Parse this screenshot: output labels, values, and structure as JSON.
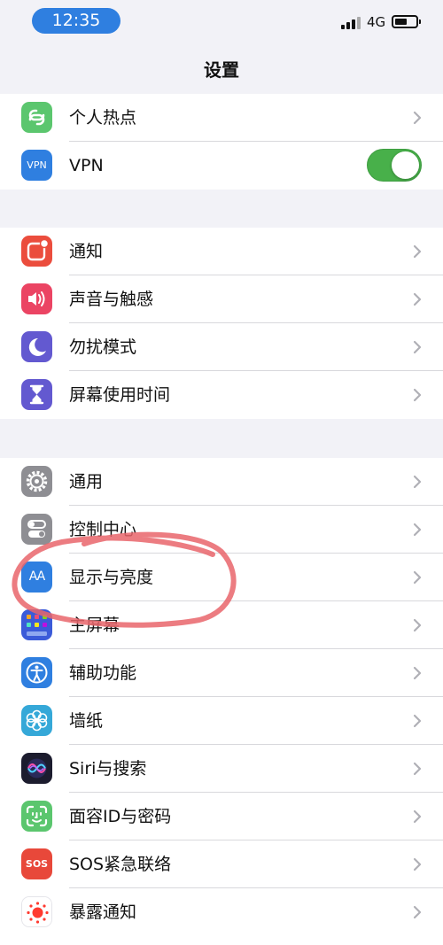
{
  "status_bar": {
    "time": "12:35",
    "network": "4G",
    "battery_level": 0.6
  },
  "nav": {
    "title": "设置"
  },
  "groups": [
    {
      "rows": [
        {
          "label": "个人热点",
          "icon": "personal-hotspot-icon",
          "color": "#5bc66e",
          "accessory": "chevron"
        },
        {
          "label": "VPN",
          "icon": "vpn-icon",
          "icon_text": "VPN",
          "color": "#2f7fe0",
          "accessory": "toggle",
          "toggle_on": true
        }
      ]
    },
    {
      "rows": [
        {
          "label": "通知",
          "icon": "notifications-icon",
          "color": "#eb4d3d",
          "accessory": "chevron"
        },
        {
          "label": "声音与触感",
          "icon": "sounds-icon",
          "color": "#eb4463",
          "accessory": "chevron"
        },
        {
          "label": "勿扰模式",
          "icon": "moon-icon",
          "color": "#6359d0",
          "accessory": "chevron"
        },
        {
          "label": "屏幕使用时间",
          "icon": "hourglass-icon",
          "color": "#6359d0",
          "accessory": "chevron"
        }
      ]
    },
    {
      "rows": [
        {
          "label": "通用",
          "icon": "gear-icon",
          "color": "#8e8e93",
          "accessory": "chevron"
        },
        {
          "label": "控制中心",
          "icon": "control-center-icon",
          "color": "#8e8e93",
          "accessory": "chevron"
        },
        {
          "label": "显示与亮度",
          "icon": "display-brightness-icon",
          "icon_text": "AA",
          "color": "#2f7fe0",
          "accessory": "chevron"
        },
        {
          "label": "主屏幕",
          "icon": "home-screen-icon",
          "color": "#3b5bd9",
          "accessory": "chevron"
        },
        {
          "label": "辅助功能",
          "icon": "accessibility-icon",
          "color": "#2f7fe0",
          "accessory": "chevron"
        },
        {
          "label": "墙纸",
          "icon": "wallpaper-icon",
          "color": "#35a8d8",
          "accessory": "chevron"
        },
        {
          "label": "Siri与搜索",
          "icon": "siri-icon",
          "color": "#1c1c2e",
          "accessory": "chevron"
        },
        {
          "label": "面容ID与密码",
          "icon": "face-id-icon",
          "color": "#5bc66e",
          "accessory": "chevron"
        },
        {
          "label": "SOS紧急联络",
          "icon": "sos-icon",
          "icon_text": "SOS",
          "color": "#e8483a",
          "accessory": "chevron"
        },
        {
          "label": "暴露通知",
          "icon": "exposure-notification-icon",
          "color": "#ffffff",
          "accessory": "chevron"
        }
      ]
    }
  ],
  "annotation": {
    "color": "#e9656b",
    "target": "显示与亮度"
  }
}
